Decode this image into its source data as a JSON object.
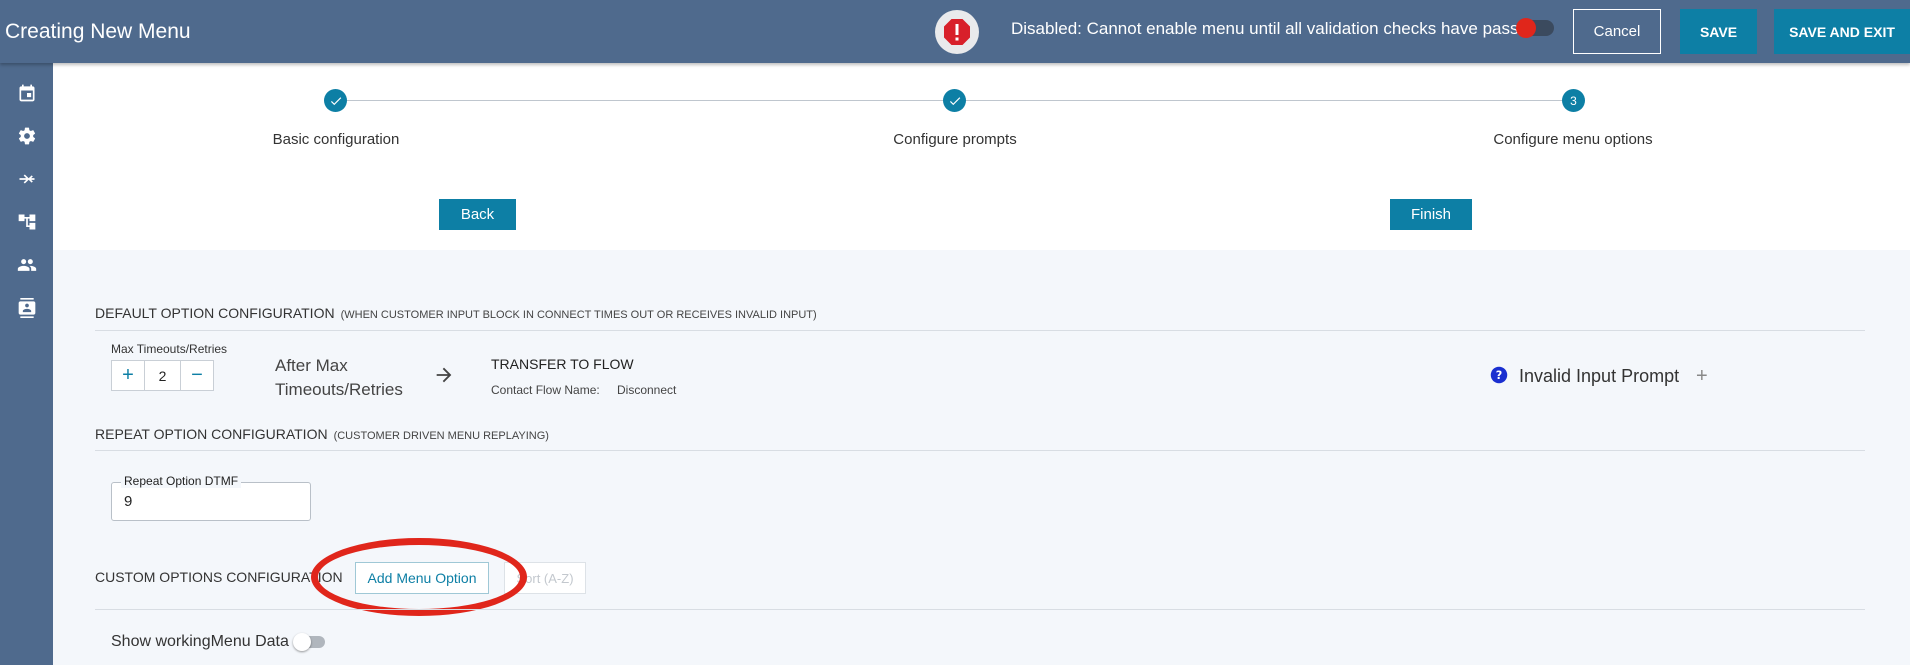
{
  "header": {
    "title": "Creating New Menu",
    "alert_icon": "exclamation-octagon-icon",
    "status_message": "Disabled: Cannot enable menu until all validation checks have passed",
    "enable_toggle": false,
    "cancel_label": "Cancel",
    "save_label": "SAVE",
    "save_exit_label": "SAVE AND EXIT"
  },
  "sidebar": {
    "items": [
      {
        "icon": "calendar-icon"
      },
      {
        "icon": "gear-icon"
      },
      {
        "icon": "transfer-arrows-icon"
      },
      {
        "icon": "flow-tree-icon"
      },
      {
        "icon": "users-icon"
      },
      {
        "icon": "contact-card-icon"
      }
    ]
  },
  "stepper": {
    "steps": [
      {
        "label": "Basic configuration",
        "state": "complete"
      },
      {
        "label": "Configure prompts",
        "state": "complete"
      },
      {
        "label": "Configure menu options",
        "state": "active",
        "number": "3"
      }
    ],
    "back_label": "Back",
    "finish_label": "Finish"
  },
  "default_option": {
    "title": "DEFAULT OPTION CONFIGURATION",
    "subtitle": "(WHEN CUSTOMER INPUT BLOCK IN CONNECT TIMES OUT OR RECEIVES INVALID INPUT)",
    "max_timeouts_label": "Max Timeouts/Retries",
    "max_timeouts_value": "2",
    "increment_symbol": "+",
    "decrement_symbol": "−",
    "after_max_label": "After Max Timeouts/Retries",
    "transfer_title": "TRANSFER TO FLOW",
    "contact_flow_label": "Contact Flow Name:",
    "contact_flow_value": "Disconnect",
    "invalid_prompt_label": "Invalid Input Prompt",
    "add_symbol": "+"
  },
  "repeat_option": {
    "title": "REPEAT OPTION CONFIGURATION",
    "subtitle": "(CUSTOMER DRIVEN MENU REPLAYING)",
    "dtmf_label": "Repeat Option DTMF",
    "dtmf_value": "9"
  },
  "custom_options": {
    "title": "CUSTOM OPTIONS CONFIGURATION",
    "add_menu_label": "Add Menu Option",
    "sort_label": "Sort (A-Z)",
    "show_data_label": "Show workingMenu Data",
    "show_data_toggle": false
  },
  "colors": {
    "topbar": "#4f6a8d",
    "accent": "#0d7fa5",
    "highlight": "#e0261b"
  }
}
